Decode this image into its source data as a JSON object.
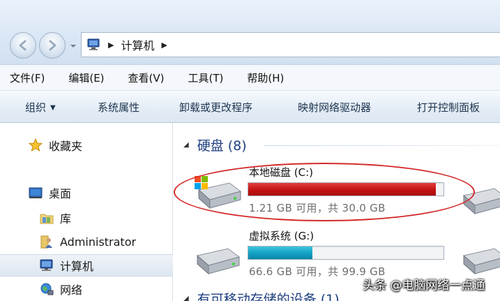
{
  "address_bar": {
    "path": "计算机"
  },
  "menu": [
    "文件(F)",
    "编辑(E)",
    "查看(V)",
    "工具(T)",
    "帮助(H)"
  ],
  "commands": {
    "organize": "组织",
    "system_properties": "系统属性",
    "uninstall": "卸载或更改程序",
    "map_drive": "映射网络驱动器",
    "control_panel": "打开控制面板"
  },
  "nav": {
    "favorites": "收藏夹",
    "desktop": "桌面",
    "libraries": "库",
    "administrator": "Administrator",
    "computer": "计算机",
    "network": "网络"
  },
  "groups": {
    "hard_disks": "硬盘 (8)",
    "removable": "有可移动存储的设备 (1)"
  },
  "drives": [
    {
      "name": "本地磁盘 (C:)",
      "size_text": "1.21 GB 可用，共 30.0 GB",
      "used_fraction": 0.96,
      "bar_color": "#c31212"
    },
    {
      "name": "虚拟系统 (G:)",
      "size_text": "66.6 GB 可用，共 99.9 GB",
      "used_fraction": 0.33,
      "bar_color": "#13a0c2"
    }
  ],
  "watermark": "头条 @电脑网络一点通"
}
